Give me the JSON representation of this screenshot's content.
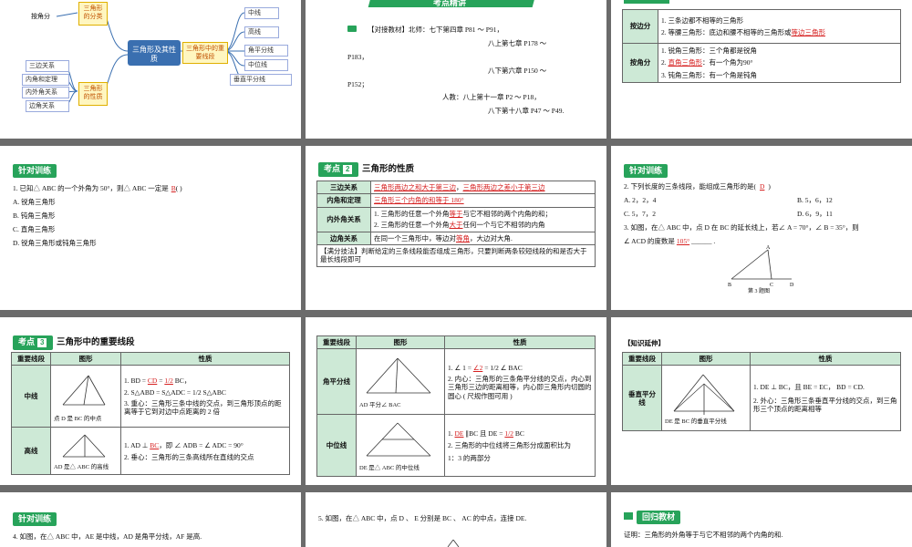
{
  "colors": {
    "accent": "#27a35a",
    "highlight": "#d62020",
    "header_fill": "#cde9d6",
    "mind_center": "#3a6fb0"
  },
  "s1": {
    "center": "三角形及其性质",
    "left_top": "按角分",
    "left_top_box": "三角形的分类",
    "left_items": [
      "三边关系",
      "内角和定理",
      "内外角关系",
      "边角关系"
    ],
    "left_bottom_box": "三角形的性质",
    "mid_box": "三角形中的重要线段",
    "right_items": [
      "中线",
      "高线",
      "角平分线",
      "中位线",
      "垂直平分线"
    ]
  },
  "s2": {
    "banner": "考点精讲",
    "book_icon": "book-icon",
    "lines": [
      "【对接教材】北师：七下第四章 P81 ～ P91，",
      "八上第七章 P178 ～",
      "P183，",
      "八下第六章 P150 ～",
      "P152；",
      "人教：八上第十一章 P2 ～ P18，",
      "八下第十八章 P47 ～ P49."
    ]
  },
  "s3": {
    "rows": [
      {
        "label": "按边分",
        "items": [
          "1. 三条边都不相等的三角形",
          "2. 等腰三角形：底边和腰不相等的三角形或",
          "等边三角形"
        ]
      },
      {
        "label": "按角分",
        "items": [
          "1. 锐角三角形：三个角都是锐角",
          "2. ",
          "直角三角形",
          "：有一个角为90°",
          "3. 钝角三角形：有一个角是钝角"
        ]
      }
    ]
  },
  "s4": {
    "tag": "针对训练",
    "q": "1. 已知△ ABC 的一个外角为 50°，则△ ABC 一定是",
    "ans": "B",
    "paren": "(      )",
    "opts": [
      "A. 锐角三角形",
      "B. 钝角三角形",
      "C. 直角三角形",
      "D. 锐角三角形或钝角三角形"
    ]
  },
  "s5": {
    "tag": "考点",
    "num": "2",
    "title": "三角形的性质",
    "rows": [
      {
        "label": "三边关系",
        "a": "三角形两边之和大于第三边",
        "b": "三角形两边之差小于第三边"
      },
      {
        "label": "内角和定理",
        "a": "三角形三个内角的和等于 180°"
      },
      {
        "label": "内外角关系",
        "l1a": "1. 三角形的任意一个外角",
        "l1r": "等于",
        "l1b": "与它不相邻的两个内角的和；",
        "l2a": "2. 三角形的任意一个外角",
        "l2r": "大于",
        "l2b": "任何一个与它不相邻的内角"
      },
      {
        "label": "边角关系",
        "a": "在同一个三角形中，等边对",
        "r": "等角",
        "b": "，大边对大角."
      }
    ],
    "tip": "【满分技法】判断给定的三条线段能否组成三角形，只要判断两条较短线段的和是否大于最长线段即可"
  },
  "s6": {
    "tag": "针对训练",
    "q2": "2. 下列长度的三条线段，能组成三角形的是",
    "ans2": "D",
    "opts": [
      "A. 2，2，4",
      "B. 5，6，12",
      "C. 5，7，2",
      "D. 6，9，11"
    ],
    "q3a": "3. 如图，在△ ABC 中，点 D 在 BC 的延长线上，若∠ A = 70°，∠ B = 35°，则",
    "q3b": "∠ ACD 的度数是",
    "ans3": "105°",
    "fig_caption": "第 3 题图",
    "fig_labels": [
      "A",
      "B",
      "C",
      "D"
    ]
  },
  "s7": {
    "tag": "考点",
    "num": "3",
    "title": "三角形中的重要线段",
    "headers": [
      "重要线段",
      "图形",
      "性质"
    ],
    "mid": {
      "label": "中线",
      "p1a": "1. BD =",
      "p1r": "CD",
      "p1b": "=",
      "p1c": "BC，",
      "p2": "2. S△ABD = S△ADC =",
      "p2b": "S△ABC",
      "p3": "3. 重心：三角形三条中线的交点，到三角形顶点的距离等于它到对边中点距离的 2 倍",
      "cap": "点 D 是 BC 的中点"
    },
    "alt": {
      "label": "高线",
      "p1a": "1. AD ⊥",
      "p1r": "BC",
      "p1b": "，即 ∠ ADB = ∠ ADC = 90°",
      "p2": "2. 垂心：三角形的三条高线所在直线的交点",
      "cap": "AD 是△ ABC 的高线"
    },
    "half": "1/2"
  },
  "s8": {
    "headers": [
      "重要线段",
      "图形",
      "性质"
    ],
    "bis": {
      "label": "角平分线",
      "p1a": "1. ∠ 1 =",
      "p1r": "∠2",
      "p1b": "=",
      "p1c": "∠ BAC",
      "p2": "2. 内心：三角形的三条角平分线的交点，内心到三角形三边的距离相等，内心即三角形内切圆的圆心 ( 尺规作图可用 )",
      "cap": "AD 平分∠ BAC"
    },
    "midl": {
      "label": "中位线",
      "p1a": "1.",
      "p1r": "DE",
      "p1b": "∥BC 且 DE =",
      "p1c": "BC",
      "p2": "2. 三角形的中位线将三角形分成面积比为",
      "p3": "1：3 的两部分",
      "cap": "DE 是△ ABC 的中位线"
    },
    "half": "1/2"
  },
  "s9": {
    "note": "【知识延伸】",
    "headers": [
      "重要线段",
      "图形",
      "性质"
    ],
    "label": "垂直平分线",
    "p1": "1. DE ⊥ BC，且 BE = EC， BD = CD.",
    "p2": "2. 外心：三角形三条垂直平分线的交点，到三角形三个顶点的距离相等",
    "cap": "DE 是 BC 的垂直平分线"
  },
  "s10": {
    "tag": "针对训练",
    "q": "4. 如图，在△ ABC 中，AE 是中线，AD 是角平分线，AF 是高."
  },
  "s11": {
    "q": "5. 如图，在△ ABC 中，点 D 、 E 分别是 BC 、 AC 的中点，连接 DE."
  },
  "s12": {
    "tag": "回归教材",
    "q": "证明：三角形的外角等于与它不相邻的两个内角的和."
  }
}
